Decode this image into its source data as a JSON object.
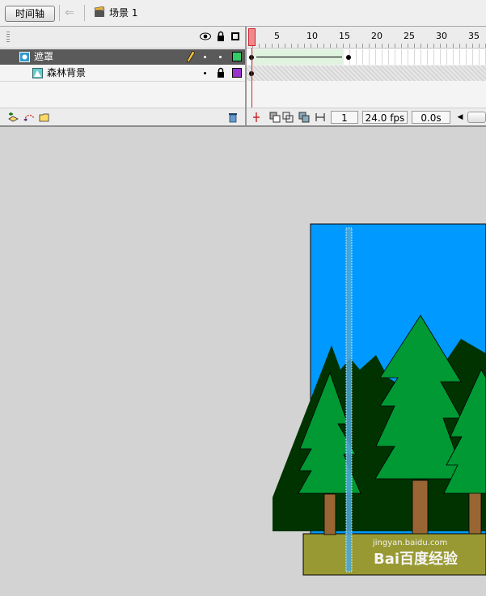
{
  "toolbar": {
    "timeline_button": "时间轴",
    "scene_label": "场景 1"
  },
  "timeline": {
    "layers": [
      {
        "name": "遮罩",
        "selected": true,
        "swatch_color": "#33cc66"
      },
      {
        "name": "森林背景",
        "selected": false,
        "swatch_color": "#9933cc"
      }
    ],
    "ruler_ticks": [
      "1",
      "5",
      "10",
      "15",
      "20",
      "25",
      "30",
      "35"
    ],
    "current_frame": "1",
    "frame_rate": "24.0 fps",
    "elapsed_time": "0.0s"
  },
  "stage": {
    "sky_color": "#0099ff",
    "ground_color": "#999933",
    "tree_color": "#009933",
    "dark_tree_color": "#003300",
    "trunk_color": "#996633"
  },
  "watermark": {
    "logo_text": "Bai百度经验",
    "url": "jingyan.baidu.com"
  }
}
